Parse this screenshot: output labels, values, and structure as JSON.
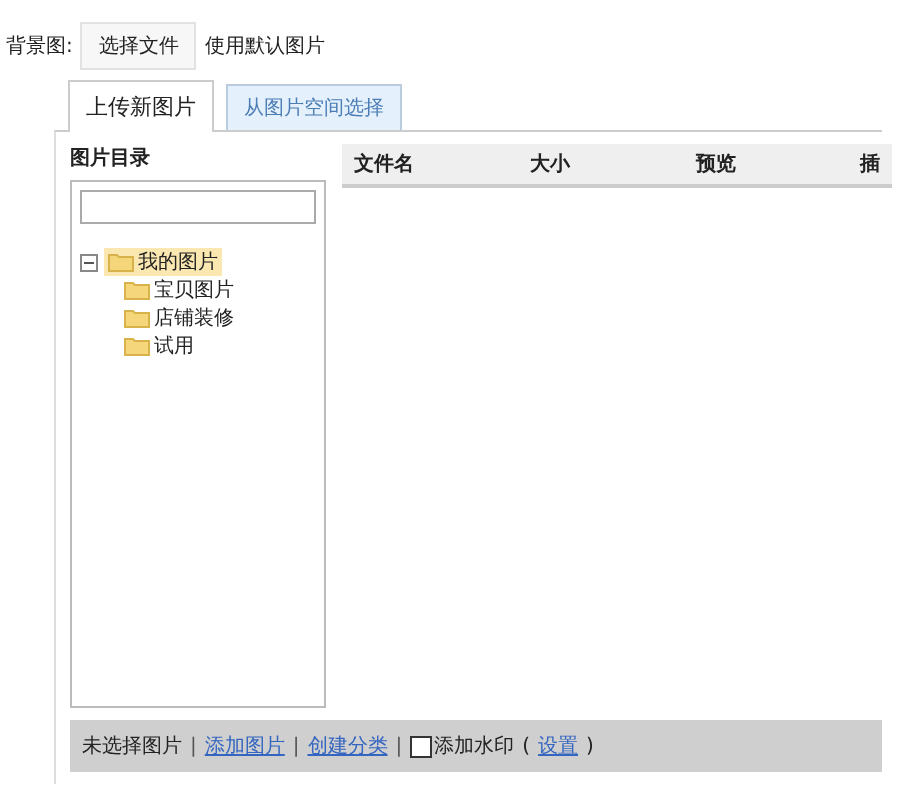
{
  "background": {
    "label": "背景图:",
    "file_button": "选择文件",
    "default_link": "使用默认图片"
  },
  "tabs": [
    {
      "label": "上传新图片",
      "selected": true
    },
    {
      "label": "从图片空间选择",
      "selected": false
    }
  ],
  "directory": {
    "title": "图片目录",
    "tree": [
      {
        "label": "我的图片",
        "expanded": true,
        "selected": true,
        "children": [
          {
            "label": "宝贝图片",
            "selected": false
          },
          {
            "label": "店铺装修",
            "selected": false
          },
          {
            "label": "试用",
            "selected": false
          }
        ]
      }
    ]
  },
  "table": {
    "columns": [
      "文件名",
      "大小",
      "预览",
      "插"
    ]
  },
  "footer": {
    "status": "未选择图片",
    "separators": [
      "|",
      "|",
      "|"
    ],
    "links": [
      "添加图片",
      "创建分类"
    ],
    "watermark": {
      "label": "添加水印",
      "checked": false,
      "open_paren": "(",
      "settings_link": "设置",
      "close_paren": ")"
    }
  }
}
